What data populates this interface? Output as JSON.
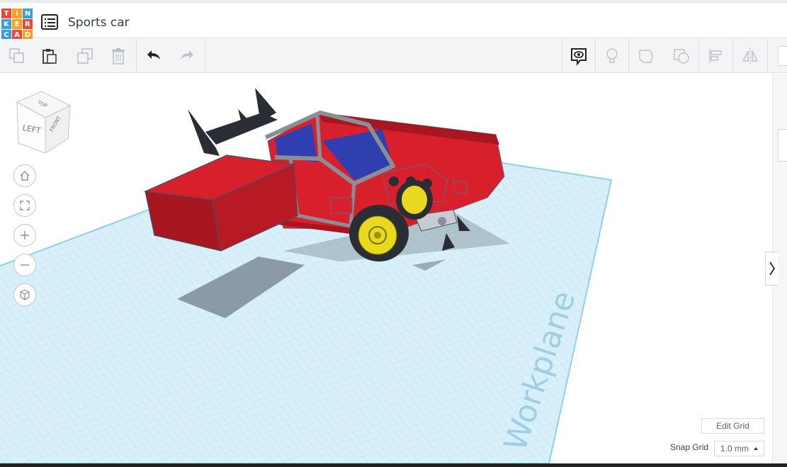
{
  "app": {
    "logo_letters": [
      "T",
      "I",
      "N",
      "K",
      "E",
      "R",
      "C",
      "A",
      "D"
    ],
    "logo_colors": [
      "#e8483f",
      "#f6a31b",
      "#3a9cd8",
      "#3a9cd8",
      "#f6a31b",
      "#e8483f",
      "#3a9cd8",
      "#e8483f",
      "#f6a31b"
    ],
    "title": "Sports car"
  },
  "toolbar": {
    "items": [
      "copy-icon",
      "paste-icon",
      "duplicate-icon",
      "delete-icon",
      "undo-icon",
      "redo-icon"
    ],
    "right_items": [
      "notes-visibility-icon",
      "lightbulb-icon",
      "shape-icon",
      "hole-icon",
      "align-icon",
      "mirror-icon"
    ]
  },
  "view": {
    "cube_labels": {
      "top": "TOP",
      "left": "LEFT",
      "front": "FRONT"
    },
    "nav": [
      "home-icon",
      "fit-view-icon",
      "zoom-in-icon",
      "zoom-out-icon",
      "ortho-view-icon"
    ]
  },
  "workplane": {
    "label": "Workplane",
    "grid_color": "#a9dcee",
    "plane_color": "#d9f0fa"
  },
  "model": {
    "body_color": "#d8202c",
    "window_color": "#2f3fb0",
    "frame_color": "#8a8f96",
    "wheel_color": "#e8d820",
    "wing_color": "#2a2d33"
  },
  "grid": {
    "edit_label": "Edit Grid",
    "snap_label": "Snap Grid",
    "snap_value": "1.0 mm"
  }
}
